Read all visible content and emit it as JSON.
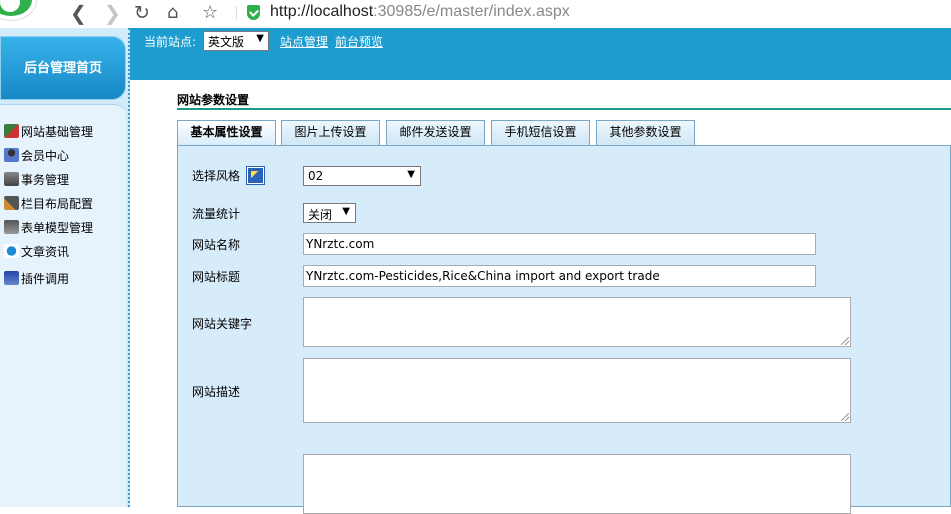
{
  "browser": {
    "url_host": "http://localhost",
    "url_rest": ":30985/e/master/index.aspx"
  },
  "header": {
    "site_label": "当前站点:",
    "site_select_value": "英文版",
    "links": [
      "站点管理",
      "前台预览"
    ]
  },
  "sidebar": {
    "home_label": "后台管理首页",
    "items": [
      {
        "label": "网站基础管理",
        "icon": "site-config-icon"
      },
      {
        "label": "会员中心",
        "icon": "members-icon"
      },
      {
        "label": "事务管理",
        "icon": "tasks-icon"
      },
      {
        "label": "栏目布局配置",
        "icon": "tools-icon"
      },
      {
        "label": "表单模型管理",
        "icon": "form-model-icon"
      },
      {
        "label": "文章资讯",
        "icon": "ie-icon"
      },
      {
        "label": "插件调用",
        "icon": "plugin-icon"
      }
    ]
  },
  "main": {
    "section_title": "网站参数设置",
    "tabs": [
      {
        "label": "基本属性设置",
        "active": true
      },
      {
        "label": "图片上传设置",
        "active": false
      },
      {
        "label": "邮件发送设置",
        "active": false
      },
      {
        "label": "手机短信设置",
        "active": false
      },
      {
        "label": "其他参数设置",
        "active": false
      }
    ],
    "form": {
      "style_label": "选择风格",
      "style_value": "02",
      "traffic_label": "流量统计",
      "traffic_value": "关闭",
      "site_name_label": "网站名称",
      "site_name_value": "YNrztc.com",
      "site_title_label": "网站标题",
      "site_title_value": "YNrztc.com-Pesticides,Rice&China import and export trade",
      "keywords_label": "网站关键字",
      "description_label": "网站描述"
    }
  },
  "colors": {
    "header_blue": "#1c9ccf",
    "panel_bg": "#d7ecfb",
    "section_rule": "#1d9a8a"
  }
}
